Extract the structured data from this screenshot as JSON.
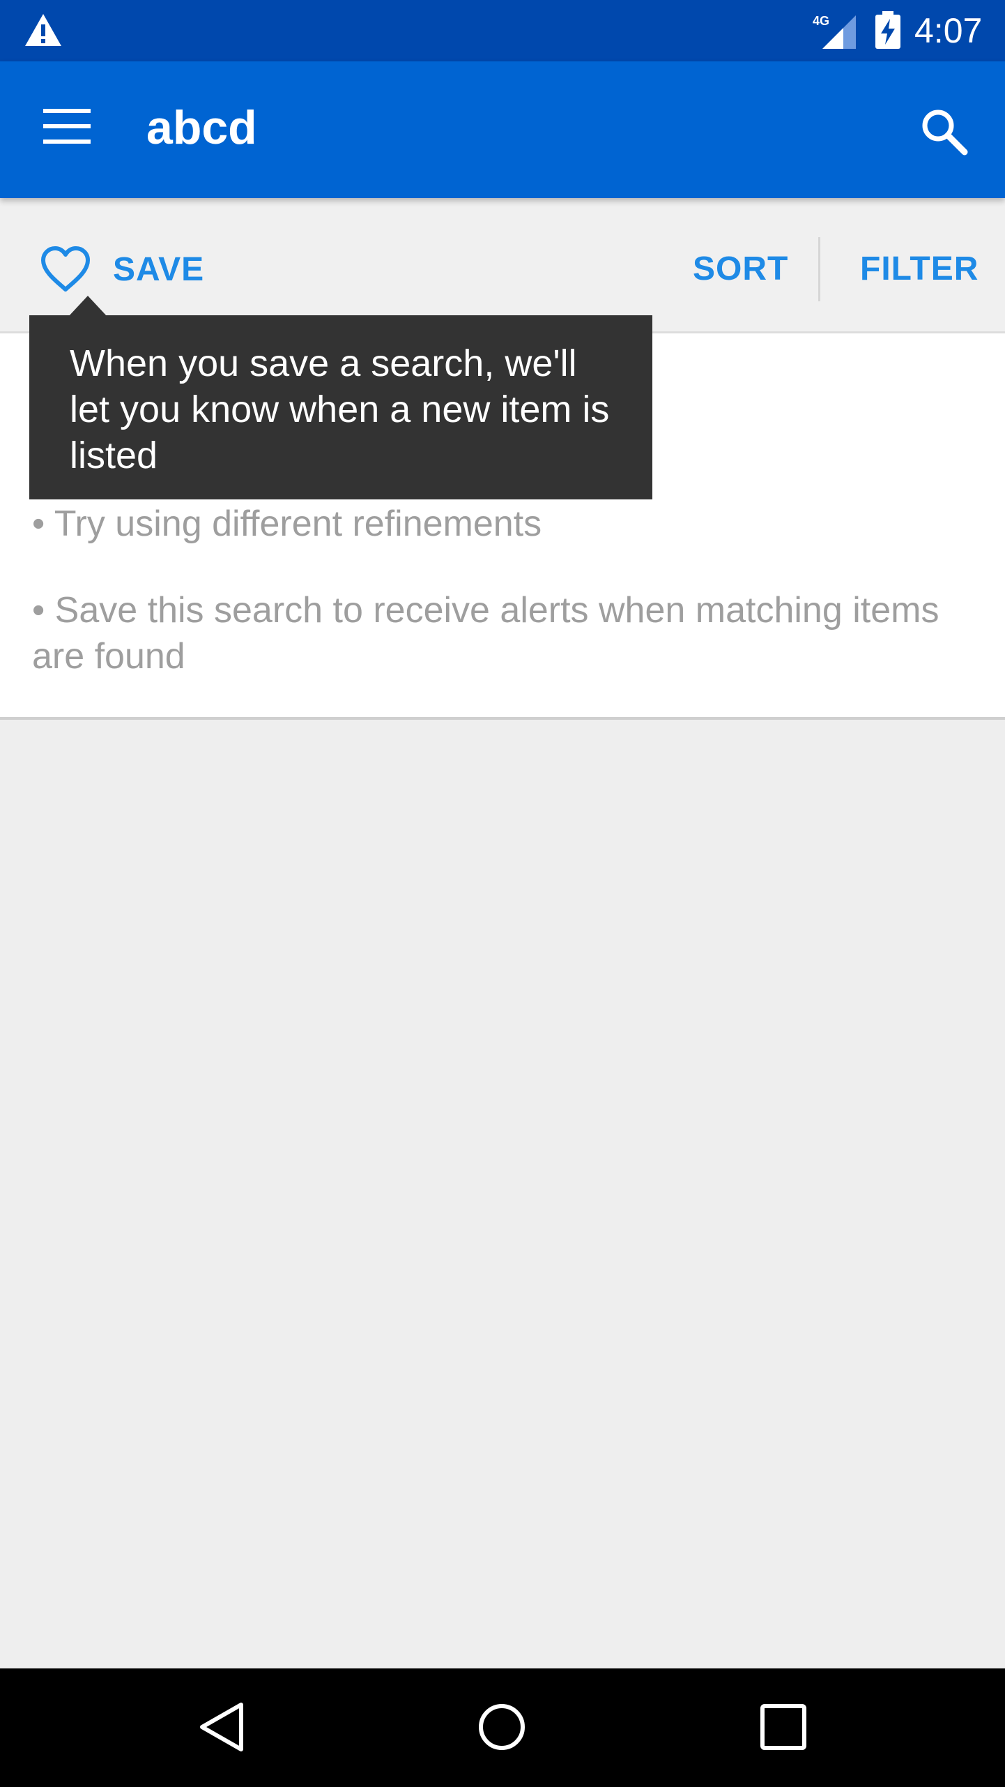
{
  "status_bar": {
    "time": "4:07",
    "network_label": "4G",
    "icons": [
      "warning-icon",
      "signal-icon",
      "battery-charging-icon"
    ]
  },
  "app_bar": {
    "title": "abcd",
    "icons": [
      "menu-icon",
      "search-icon"
    ]
  },
  "toolbar": {
    "save_label": "SAVE",
    "sort_label": "SORT",
    "filter_label": "FILTER",
    "save_icon": "heart-outline-icon"
  },
  "tooltip": {
    "text": "When you save a search, we'll let you know when a new item is listed"
  },
  "content": {
    "tips": [
      "• Try using different refinements",
      "• Save this search to receive alerts when matching items are found"
    ]
  },
  "nav_bar": {
    "icons": [
      "back-icon",
      "home-icon",
      "recents-icon"
    ]
  },
  "colors": {
    "status_bar": "#0048ad",
    "app_bar": "#0064d2",
    "accent": "#1e8ae6",
    "tooltip_bg": "#333333",
    "tip_text": "#9e9e9e",
    "background": "#eeeeee"
  }
}
